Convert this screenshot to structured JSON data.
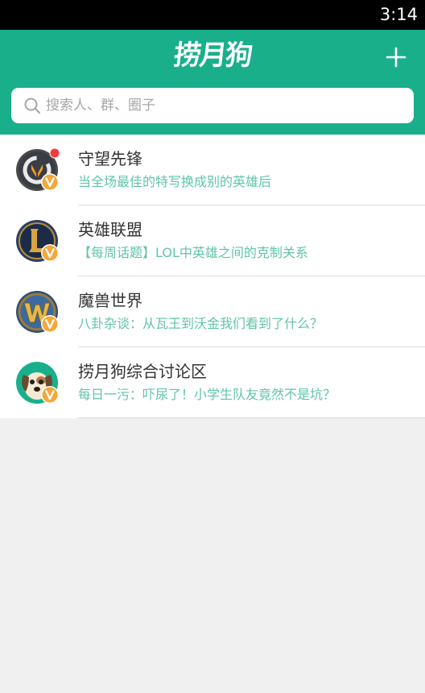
{
  "status_bar": {
    "time": "3:14"
  },
  "header": {
    "logo_text": "捞月狗"
  },
  "search": {
    "placeholder": "搜索人、群、圈子"
  },
  "groups": [
    {
      "name": "守望先锋",
      "latest": "当全场最佳的特写换成别的英雄后",
      "avatar_icon": "overwatch-logo-icon",
      "verified": true,
      "unread_dot": true
    },
    {
      "name": "英雄联盟",
      "latest": "【每周话题】LOL中英雄之间的克制关系",
      "avatar_icon": "league-of-legends-logo-icon",
      "verified": true,
      "unread_dot": false
    },
    {
      "name": "魔兽世界",
      "latest": "八卦杂谈：从瓦王到沃金我们看到了什么？",
      "avatar_icon": "world-of-warcraft-logo-icon",
      "verified": true,
      "unread_dot": false
    },
    {
      "name": "捞月狗综合讨论区",
      "latest": "每日一污：吓尿了！小学生队友竟然不是坑？",
      "avatar_icon": "laoyuegou-dog-mascot-icon",
      "verified": true,
      "unread_dot": false
    }
  ],
  "colors": {
    "brand": "#1aaf8b",
    "subtitle": "#5fc4a8",
    "verified_badge": "#f3a839",
    "unread_dot": "#f03c3c",
    "background": "#f0f0f0"
  }
}
